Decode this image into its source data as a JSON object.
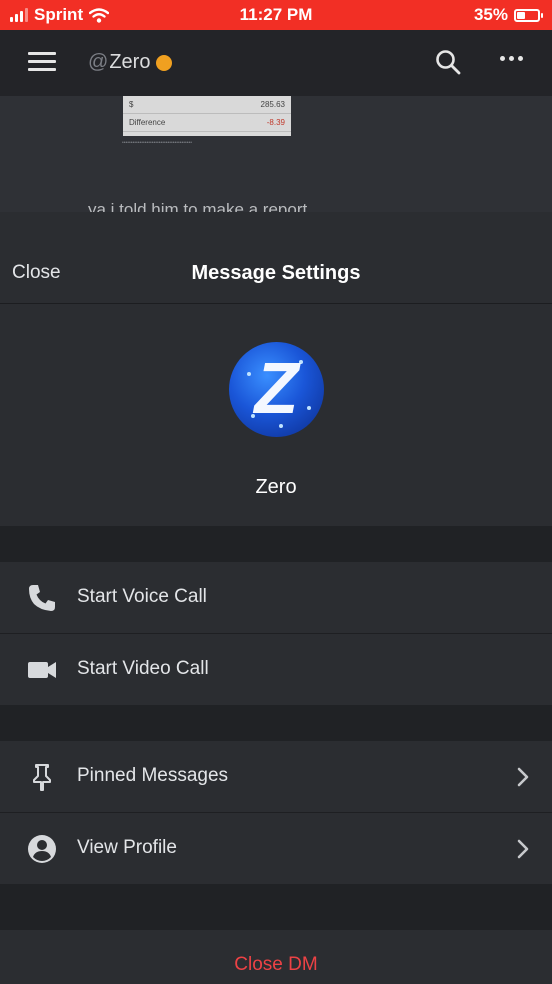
{
  "status_bar": {
    "carrier": "Sprint",
    "time": "11:27 PM",
    "battery": "35%",
    "battery_level": 0.35
  },
  "chat": {
    "channel_prefix": "@",
    "channel_name": "Zero",
    "status_color": "#f0a020",
    "attachment_rows": [
      {
        "label": "$",
        "value": "285.63"
      },
      {
        "label": "Difference",
        "value": "-8.39"
      }
    ],
    "background_message": "ya i told him to make a report"
  },
  "sheet": {
    "close_label": "Close",
    "title": "Message Settings",
    "avatar_letter": "Z",
    "username": "Zero",
    "actions": [
      {
        "label": "Start Voice Call",
        "icon": "phone-icon"
      },
      {
        "label": "Start Video Call",
        "icon": "video-camera-icon"
      }
    ],
    "links": [
      {
        "label": "Pinned Messages",
        "icon": "pin-icon"
      },
      {
        "label": "View Profile",
        "icon": "user-circle-icon"
      }
    ],
    "close_dm_label": "Close DM"
  },
  "colors": {
    "status_bar": "#f22f25",
    "danger": "#ed4245",
    "surface": "#2b2d31",
    "background": "#202225"
  }
}
